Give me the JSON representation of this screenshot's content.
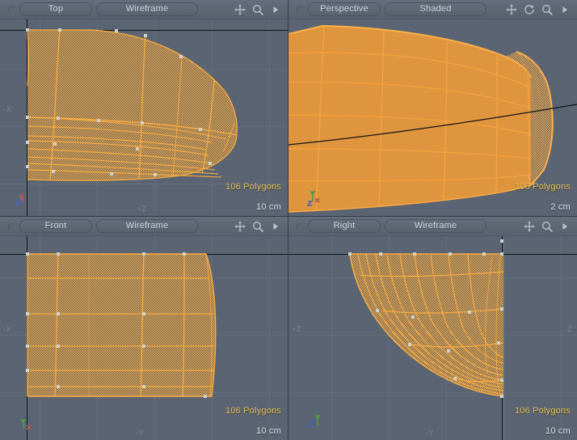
{
  "app": {
    "background_color": "#5b6472",
    "wire_color": "#f5a53c",
    "fill_color": "#d98c2e",
    "poly_text_color": "#e8c35a",
    "scale_text_color": "#dfe4ea"
  },
  "viewports": [
    {
      "id": "top-left",
      "view_label": "Top",
      "shading_label": "Wireframe",
      "poly_count": "106 Polygons",
      "scale": "10 cm",
      "axis_left": "-X",
      "axis_bottom": "+Z",
      "icons": [
        "move-icon",
        "magnify-icon",
        "chevron-right-icon"
      ]
    },
    {
      "id": "top-right",
      "view_label": "Perspective",
      "shading_label": "Shaded",
      "poly_count": "106 Polygons",
      "scale": "2 cm",
      "axis_left": "",
      "axis_bottom": "",
      "icons": [
        "move-icon",
        "rotate-icon",
        "magnify-icon",
        "chevron-right-icon"
      ]
    },
    {
      "id": "bottom-left",
      "view_label": "Front",
      "shading_label": "Wireframe",
      "poly_count": "106 Polygons",
      "scale": "10 cm",
      "axis_left": "-X",
      "axis_bottom": "-Y",
      "icons": [
        "move-icon",
        "magnify-icon",
        "chevron-right-icon"
      ]
    },
    {
      "id": "bottom-right",
      "view_label": "Right",
      "shading_label": "Wireframe",
      "poly_count": "106 Polygons",
      "scale": "10 cm",
      "axis_left": "+Z",
      "axis_right": "-Z",
      "axis_bottom": "-Y",
      "icons": [
        "move-icon",
        "magnify-icon",
        "chevron-right-icon"
      ]
    }
  ]
}
